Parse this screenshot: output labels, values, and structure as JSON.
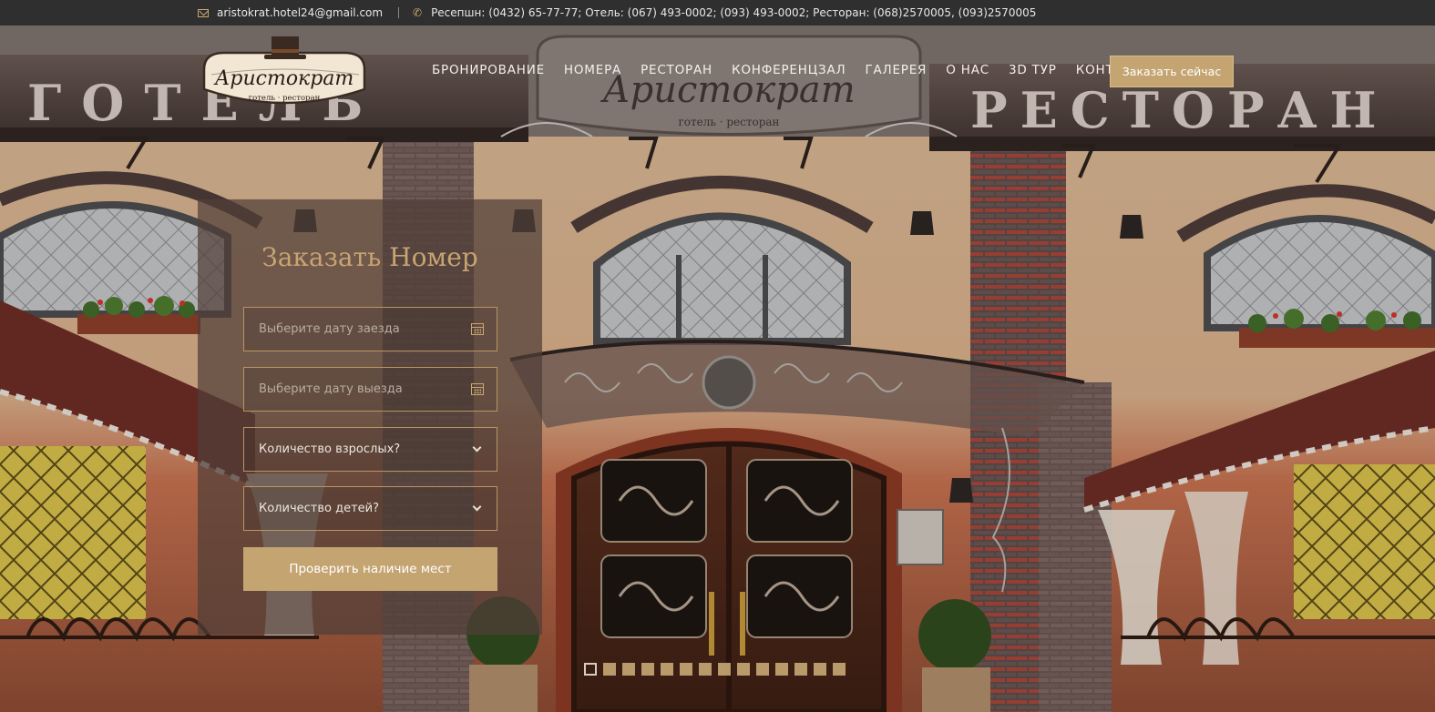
{
  "topbar": {
    "email": "aristokrat.hotel24@gmail.com",
    "phones": "Ресепшн: (0432) 65-77-77; Отель: (067) 493-0002; (093) 493-0002; Ресторан: (068)2570005, (093)2570005"
  },
  "logo": {
    "name": "Аристократ",
    "tagline": "готель · ресторан"
  },
  "nav": {
    "items": [
      "БРОНИРОВАНИЕ",
      "НОМЕРА",
      "РЕСТОРАН",
      "КОНФЕРЕНЦЗАЛ",
      "ГАЛЕРЕЯ",
      "О НАС",
      "3D ТУР",
      "КОНТАКТЫ"
    ],
    "order_button": "Заказать сейчас"
  },
  "booking": {
    "title": "Заказать Номер",
    "checkin_placeholder": "Выберите дату заезда",
    "checkout_placeholder": "Выберите дату выезда",
    "adults": "Количество взрослых?",
    "children": "Количество детей?",
    "submit": "Проверить наличие мест"
  },
  "hero": {
    "sign_center": "Аристократ",
    "sign_center_tagline": "готель · ресторан",
    "sign_left": "ГОТЕЛЬ",
    "sign_right": "РЕСТОРАН"
  },
  "slider": {
    "count": 14,
    "active_index": 0
  },
  "colors": {
    "accent": "#c4a572",
    "topbar": "#2f2f2f",
    "title": "#c7a472"
  }
}
